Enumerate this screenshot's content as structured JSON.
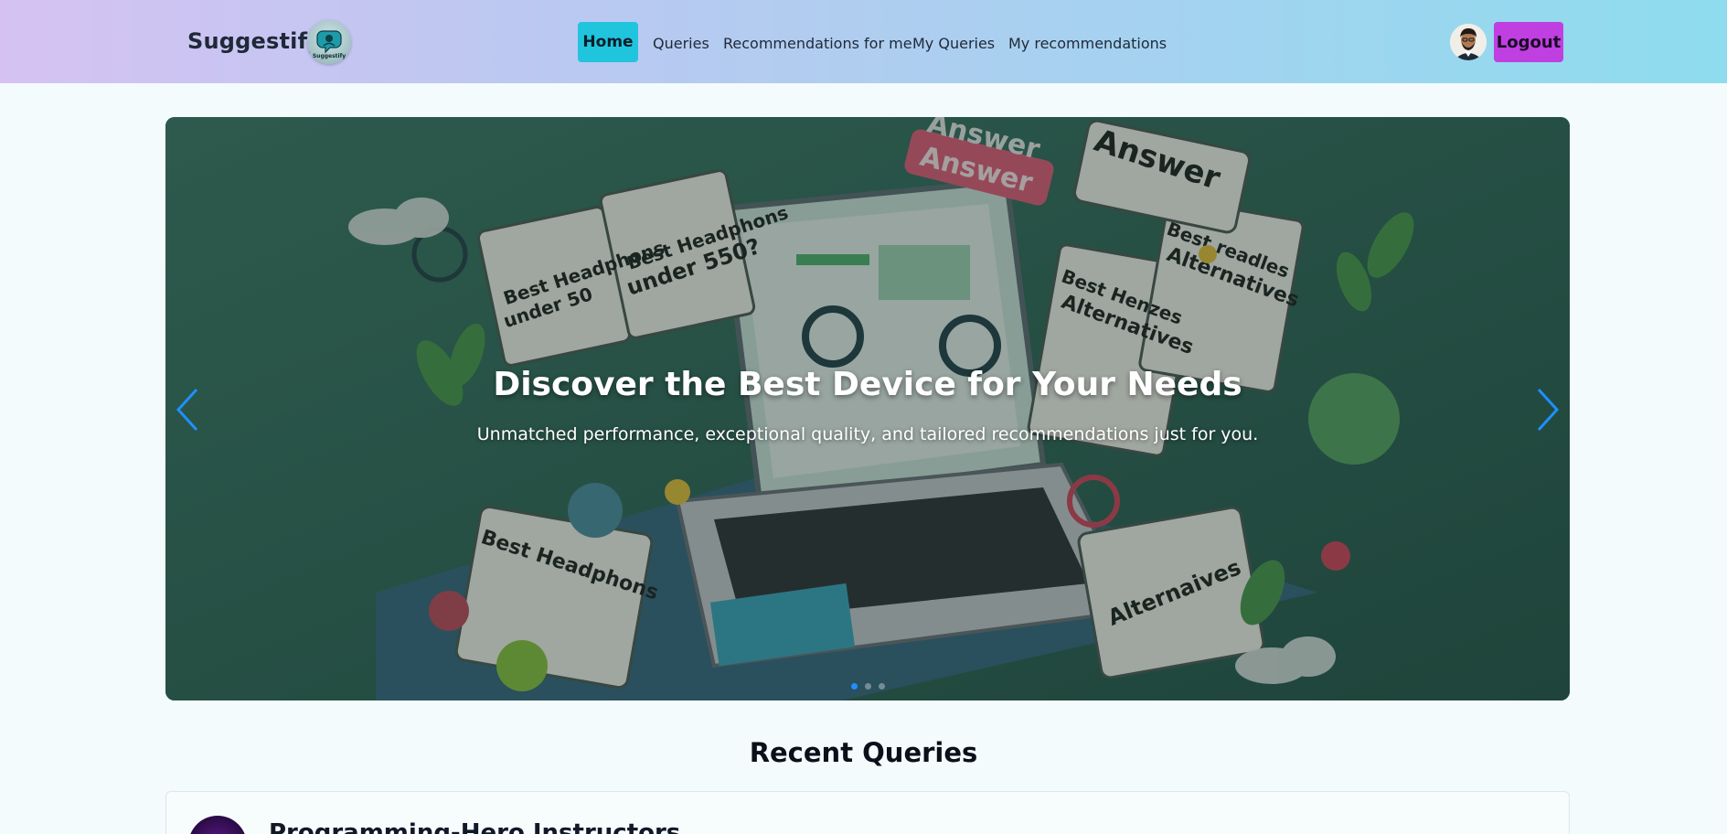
{
  "app": {
    "brand": "Suggestify",
    "logo_text": "Suggestify"
  },
  "nav": {
    "items": [
      {
        "label": "Home",
        "active": true
      },
      {
        "label": "Queries",
        "active": false
      },
      {
        "label": "Recommendations for me",
        "active": false
      },
      {
        "label": "My Queries",
        "active": false
      },
      {
        "label": "My recommendations",
        "active": false
      }
    ],
    "logout_label": "Logout",
    "active_color": "#20c5dd",
    "logout_color": "#bf3fe0"
  },
  "hero": {
    "title": "Discover the Best Device for Your Needs",
    "subtitle": "Unmatched performance, exceptional quality, and tailored recommendations just for you.",
    "slides_count": 3,
    "active_slide": 1,
    "image_texts": [
      "Best Headphons under 550?",
      "Best Headphons under 50",
      "Answer",
      "Answer",
      "Best Alternatives",
      "Best Headphons",
      "Alternaives"
    ],
    "prev_icon": "chevron-left-icon",
    "next_icon": "chevron-right-icon"
  },
  "recent": {
    "heading": "Recent Queries",
    "queries": [
      {
        "title": "Programming-Hero Instructors"
      }
    ]
  }
}
